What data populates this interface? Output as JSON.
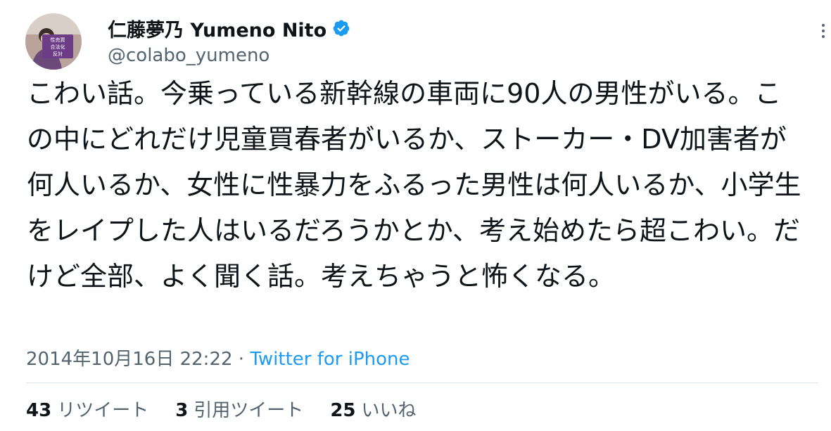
{
  "author": {
    "display_name": "仁藤夢乃  Yumeno Nito",
    "handle": "@colabo_yumeno",
    "verified_color": "#1d9bf0",
    "avatar_sign_text": "性売買\n合法化\n反対"
  },
  "tweet": {
    "text": "こわい話。今乗っている新幹線の車両に90人の男性がいる。この中にどれだけ児童買春者がいるか、ストーカー・DV加害者が何人いるか、女性に性暴力をふるった男性は何人いるか、小学生をレイプした人はいるだろうかとか、考え始めたら超こわい。だけど全部、よく聞く話。考えちゃうと怖くなる。",
    "timestamp": "2014年10月16日 22:22",
    "separator": "·",
    "source": "Twitter for iPhone"
  },
  "stats": {
    "retweets_count": "43",
    "retweets_label": "リツイート",
    "quotes_count": "3",
    "quotes_label": "引用ツイート",
    "likes_count": "25",
    "likes_label": "いいね"
  },
  "icons": {
    "verified": "verified-badge-icon",
    "more": "more-options-icon"
  },
  "colors": {
    "text": "#0f1419",
    "secondary": "#536471",
    "link": "#1d9bf0"
  }
}
